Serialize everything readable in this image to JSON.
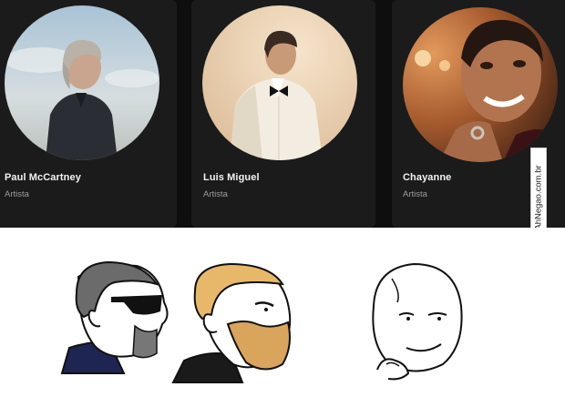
{
  "artists": [
    {
      "name": "Paul McCartney",
      "subtitle": "Artista"
    },
    {
      "name": "Luis Miguel",
      "subtitle": "Artista"
    },
    {
      "name": "Chayanne",
      "subtitle": "Artista"
    }
  ],
  "watermark": "AhNegao.com.br",
  "colors": {
    "page_background": "#0e0e0e",
    "card_background": "#1b1b1b",
    "name_text": "#f2f2f2",
    "subtitle_text": "#9c9c9c"
  },
  "meme_faces": [
    "sunglasses-chad-face",
    "bearded-chad-face",
    "smirking-wojak-face"
  ]
}
